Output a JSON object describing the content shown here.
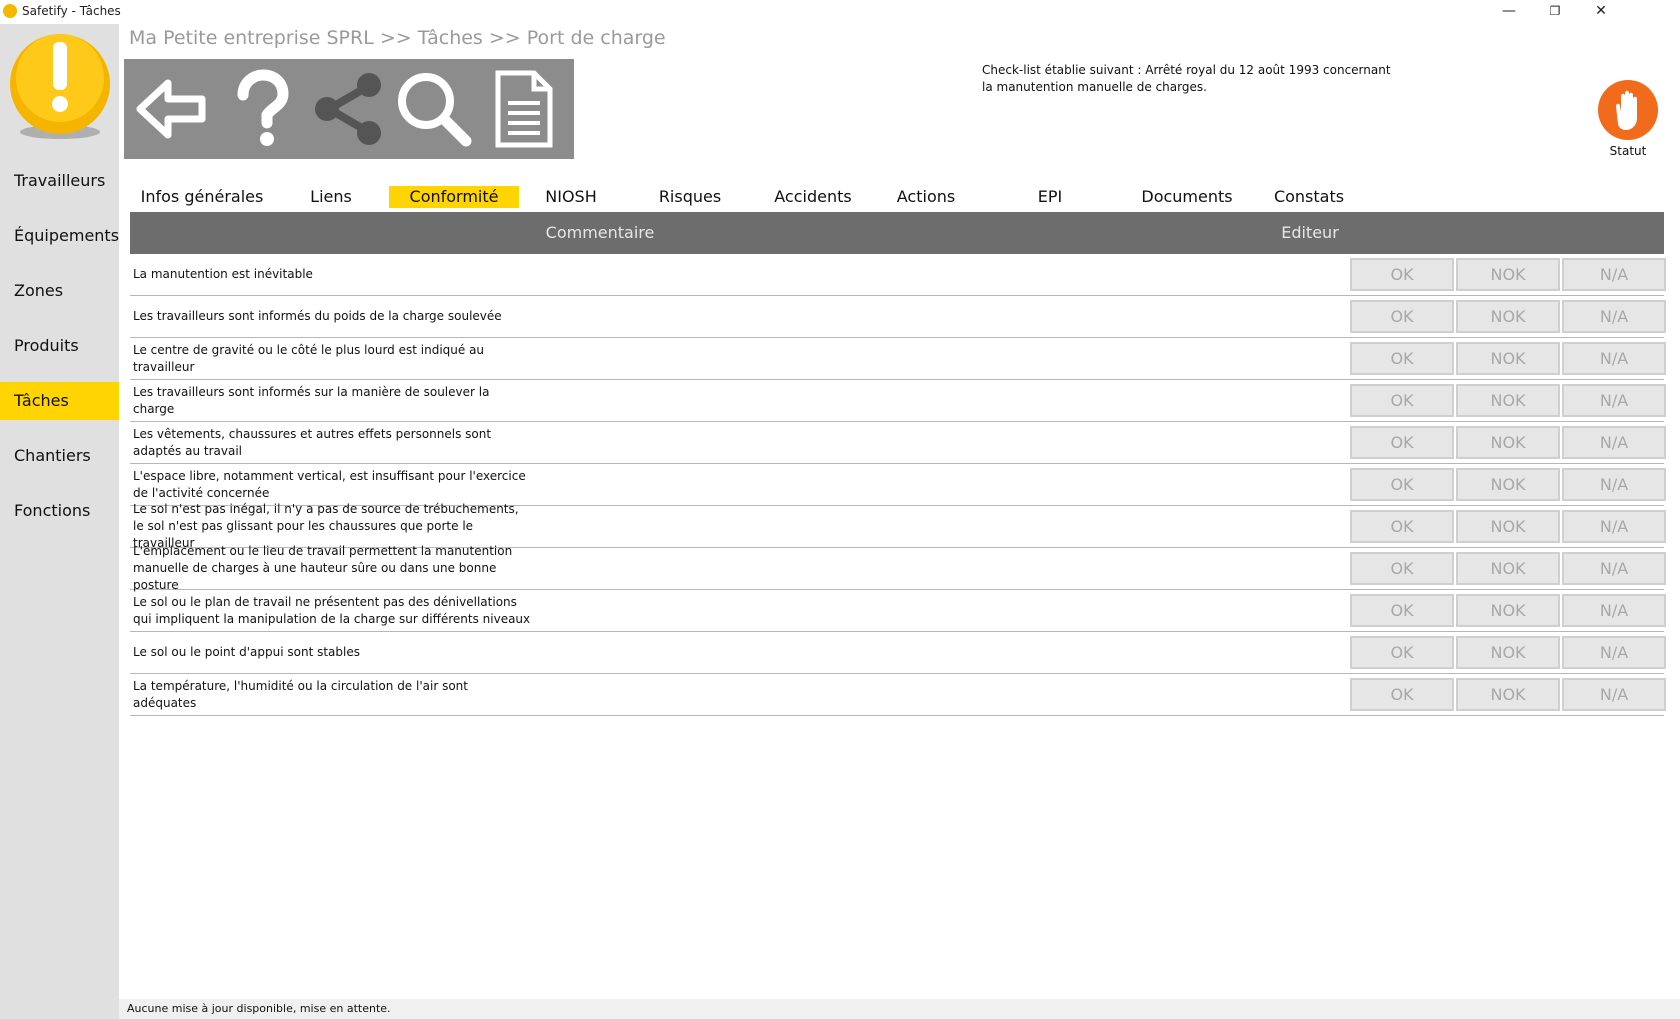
{
  "window": {
    "title": "Safetify - Tâches",
    "minimize": "—",
    "restore": "❐",
    "close": "✕"
  },
  "sidebar": {
    "items": [
      {
        "label": "Travailleurs",
        "active": false
      },
      {
        "label": "Équipements",
        "active": false
      },
      {
        "label": "Zones",
        "active": false
      },
      {
        "label": "Produits",
        "active": false
      },
      {
        "label": "Tâches",
        "active": true
      },
      {
        "label": "Chantiers",
        "active": false
      },
      {
        "label": "Fonctions",
        "active": false
      }
    ]
  },
  "breadcrumb": "Ma Petite entreprise SPRL >> Tâches >> Port de charge",
  "toolbar": {
    "icons": [
      "back-icon",
      "help-icon",
      "share-icon",
      "search-icon",
      "document-icon"
    ]
  },
  "checklist_reference": "Check-list établie suivant : Arrêté royal du 12 août 1993 concernant la manutention manuelle de charges.",
  "statut": {
    "label": "Statut",
    "icon": "hand-stop-icon",
    "color": "#f26a1b"
  },
  "tabs": [
    {
      "label": "Infos générales",
      "active": false
    },
    {
      "label": "Liens",
      "active": false
    },
    {
      "label": "Conformité",
      "active": true
    },
    {
      "label": "NIOSH",
      "active": false
    },
    {
      "label": "Risques",
      "active": false
    },
    {
      "label": "Accidents",
      "active": false
    },
    {
      "label": "Actions",
      "active": false
    },
    {
      "label": "EPI",
      "active": false
    },
    {
      "label": "Documents",
      "active": false
    },
    {
      "label": "Constats",
      "active": false
    }
  ],
  "table": {
    "headers": {
      "comment": "Commentaire",
      "editor": "Editeur"
    },
    "choice_labels": {
      "ok": "OK",
      "nok": "NOK",
      "na": "N/A"
    },
    "rows": [
      "La manutention est inévitable",
      "Les travailleurs sont informés du poids de la charge soulevée",
      "Le centre de gravité ou le côté le plus lourd est indiqué au travailleur",
      "Les travailleurs sont informés sur la manière de soulever la charge",
      "Les vêtements, chaussures et autres effets personnels sont adaptés au travail",
      "L'espace libre, notamment vertical, est insuffisant pour l'exercice de l'activité concernée",
      "Le sol n'est pas inégal, il n'y a pas de source de trébuchements, le sol n'est pas glissant pour les chaussures que porte le travailleur",
      "L'emplacement ou le lieu de travail permettent la manutention manuelle de charges à une hauteur sûre ou dans une bonne posture",
      "Le sol ou le plan de travail ne présentent pas des dénivellations qui impliquent la manipulation de la charge sur différents niveaux",
      "Le sol ou le point d'appui sont stables",
      "La température, l'humidité ou la circulation de l'air sont adéquates"
    ]
  },
  "status_bar": "Aucune mise à jour disponible, mise en attente.",
  "colors": {
    "accent": "#ffd400",
    "toolbar": "#8c8c8c",
    "header": "#6d6d6d",
    "sidebar": "#e0e0e0"
  }
}
